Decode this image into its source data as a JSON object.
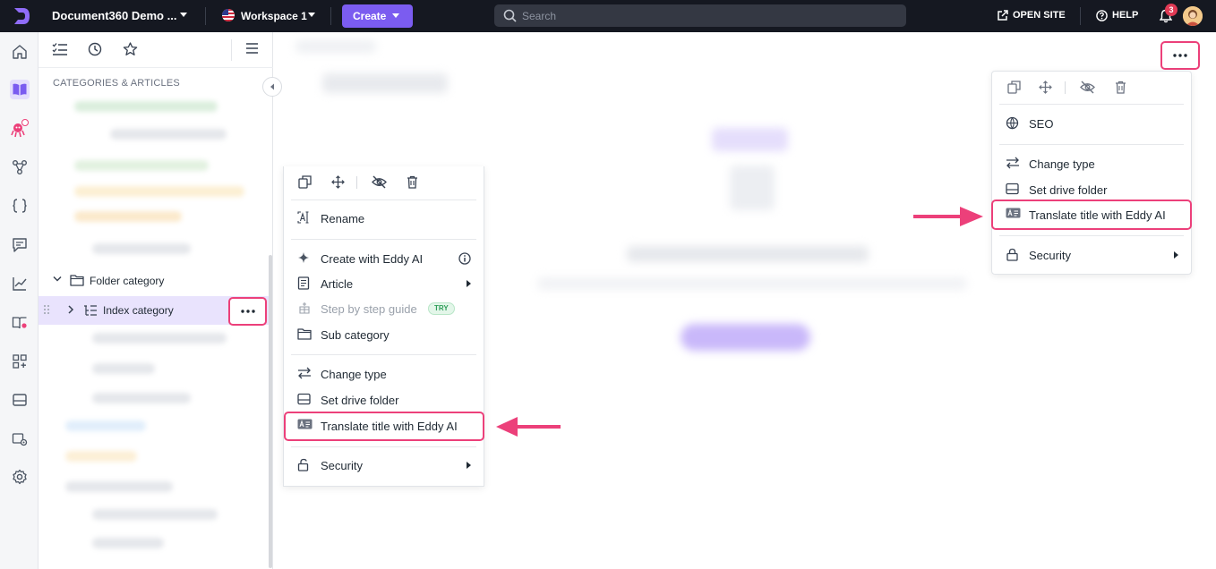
{
  "topbar": {
    "project_name": "Document360 Demo ...",
    "workspace": "Workspace 1",
    "create_label": "Create",
    "search_placeholder": "Search",
    "open_site_label": "OPEN SITE",
    "help_label": "HELP",
    "notification_count": "3"
  },
  "rail": {
    "icons": [
      "home-icon",
      "documentation-icon",
      "eddy-ai-icon",
      "api-icon",
      "code-icon",
      "feedback-icon",
      "analytics-icon",
      "knowledge-base-icon",
      "integrations-icon",
      "drive-icon",
      "widget-settings-icon",
      "settings-icon"
    ]
  },
  "sidebar": {
    "header": "CATEGORIES & ARTICLES",
    "folder_label": "Folder category",
    "index_label": "Index category"
  },
  "left_menu": {
    "items": {
      "rename": "Rename",
      "create_eddy": "Create with Eddy AI",
      "article": "Article",
      "step_guide": "Step by step guide",
      "try_badge": "TRY",
      "sub_category": "Sub category",
      "change_type": "Change type",
      "set_drive": "Set drive folder",
      "translate": "Translate title with Eddy AI",
      "security": "Security"
    }
  },
  "right_menu": {
    "items": {
      "seo": "SEO",
      "change_type": "Change type",
      "set_drive": "Set drive folder",
      "translate": "Translate title with Eddy AI",
      "security": "Security"
    }
  },
  "colors": {
    "topbar_bg": "#151821",
    "accent": "#7b5cf0",
    "highlight": "#ec407a",
    "selected_row": "#e9e3fd"
  }
}
